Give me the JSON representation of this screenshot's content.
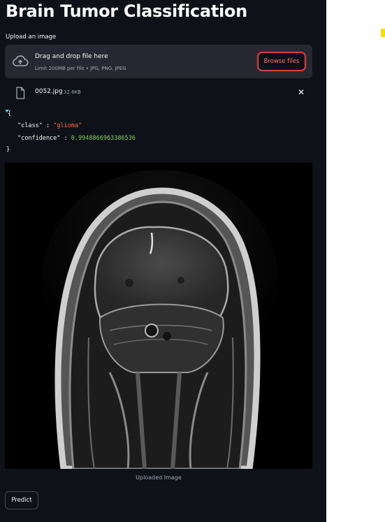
{
  "app": {
    "title": "Brain Tumor Classification",
    "upload_label": "Upload an image"
  },
  "uploader": {
    "dropzone_title": "Drag and drop file here",
    "limit_text": "Limit 200MB per file • JPG, PNG, JPEG",
    "browse_label": "Browse files",
    "icon": "cloud-upload-icon"
  },
  "file": {
    "name": "0052.jpg",
    "size": "32.6KB",
    "icon": "file-icon",
    "close_icon": "close-icon"
  },
  "result": {
    "open_brace": "{",
    "close_brace": "}",
    "class_key": "\"class\"",
    "class_value": "\"glioma\"",
    "confidence_key": "\"confidence\"",
    "confidence_value": "0.9948866963386536",
    "colon": ":"
  },
  "image": {
    "caption": "Uploaded Image"
  },
  "actions": {
    "predict_label": "Predict"
  },
  "colors": {
    "background": "#0e1117",
    "panel": "#262730",
    "accent": "#ff4b4b",
    "json_string": "#ff7043",
    "json_number": "#7cd35a"
  }
}
